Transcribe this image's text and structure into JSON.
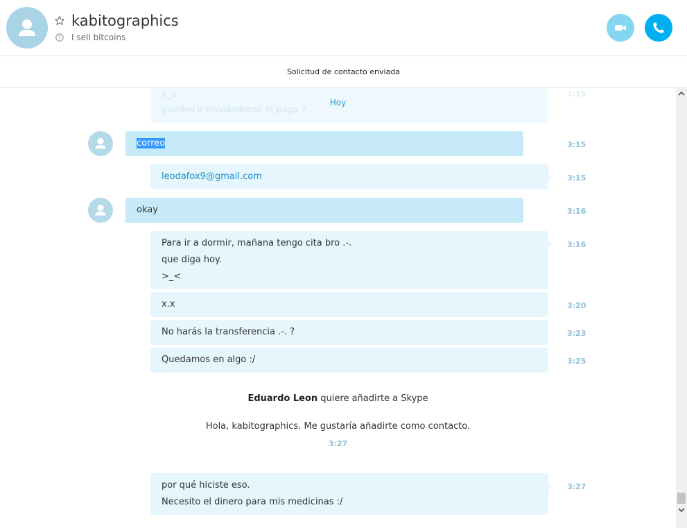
{
  "header": {
    "contact_name": "kabitographics",
    "mood": "I sell bitcoins",
    "icons": {
      "avatar": "person-icon",
      "favorite": "star-icon",
      "mood": "help-circle-icon",
      "video": "video-camera-icon",
      "call": "phone-icon"
    },
    "colors": {
      "video_button": "#84d6f3",
      "call_button": "#00aff0"
    }
  },
  "notice": "Solicitud de contacto enviada",
  "chat": {
    "faded_lines": [
      "x_x",
      "puedes ir enviándome el pago ?"
    ],
    "day_separator": "Hoy",
    "messages": [
      {
        "direction": "incoming",
        "lines": [
          "correo"
        ],
        "time": "3:15",
        "selected": true
      },
      {
        "direction": "outgoing",
        "lines": [
          "leodafox9@gmail.com"
        ],
        "time": "3:15",
        "link": true
      },
      {
        "direction": "incoming",
        "lines": [
          "okay"
        ],
        "time": "3:16"
      },
      {
        "direction": "outgoing",
        "lines": [
          "Para ir a dormir, mañana tengo cita bro .-.",
          "que diga hoy.",
          ">_<"
        ],
        "time": "3:16"
      },
      {
        "direction": "outgoing",
        "lines": [
          "x.x"
        ],
        "time": "3:20"
      },
      {
        "direction": "outgoing",
        "lines": [
          "No harás la transferencia .-. ?"
        ],
        "time": "3:23"
      },
      {
        "direction": "outgoing",
        "lines": [
          "Quedamos en algo :/"
        ],
        "time": "3:25"
      }
    ],
    "contact_request": {
      "sender": "Eduardo Leon",
      "action": "quiere añadirte a Skype",
      "message": "Hola, kabitographics. Me gustaría añadirte como contacto.",
      "time": "3:27"
    },
    "last_message": {
      "direction": "outgoing",
      "lines": [
        "por qué hiciste eso.",
        "Necesito el dinero para mis medicinas :/"
      ],
      "time": "3:27"
    }
  },
  "colors": {
    "incoming_bubble": "#c7eaf8",
    "outgoing_bubble": "#e5f6fd",
    "timestamp": "#8fbfd6",
    "accent": "#2b9fcf"
  }
}
